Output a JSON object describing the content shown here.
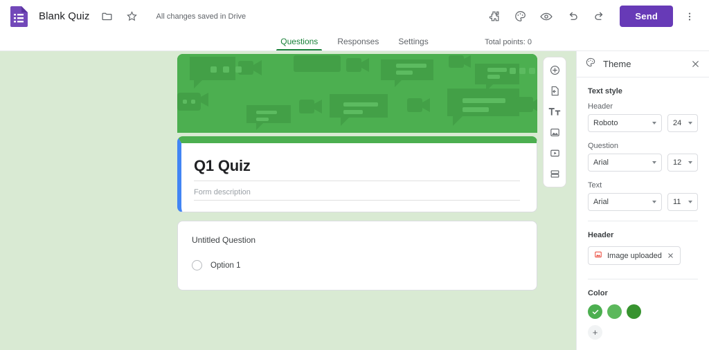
{
  "topbar": {
    "logo_icon": "forms-logo-icon",
    "doc_title": "Blank Quiz",
    "folder_icon": "folder-icon",
    "star_icon": "star-icon",
    "save_status": "All changes saved in Drive",
    "addons_icon": "puzzle-addons-icon",
    "theme_icon": "palette-theme-icon",
    "preview_icon": "eye-preview-icon",
    "undo_icon": "undo-icon",
    "redo_icon": "redo-icon",
    "send_label": "Send",
    "more_icon": "more-vert-icon"
  },
  "tabs": [
    {
      "label": "Questions",
      "active": true
    },
    {
      "label": "Responses",
      "active": false
    },
    {
      "label": "Settings",
      "active": false
    }
  ],
  "total_points": "Total points: 0",
  "form": {
    "banner_alt": "header-image-green-chat-video",
    "title": "Q1 Quiz",
    "description_placeholder": "Form description",
    "question": {
      "title": "Untitled Question",
      "options": [
        "Option 1"
      ]
    }
  },
  "float_toolbar": [
    {
      "icon": "add-question-icon"
    },
    {
      "icon": "import-questions-icon"
    },
    {
      "icon": "add-title-description-icon"
    },
    {
      "icon": "add-image-icon"
    },
    {
      "icon": "add-video-icon"
    },
    {
      "icon": "add-section-icon"
    }
  ],
  "theme_panel": {
    "icon": "palette-icon",
    "title": "Theme",
    "close_icon": "close-icon",
    "text_style_heading": "Text style",
    "fields": [
      {
        "label": "Header",
        "font": "Roboto",
        "size": "24"
      },
      {
        "label": "Question",
        "font": "Arial",
        "size": "12"
      },
      {
        "label": "Text",
        "font": "Arial",
        "size": "11"
      }
    ],
    "header_section": {
      "heading": "Header",
      "chip_icon": "image-icon",
      "chip_label": "Image uploaded",
      "chip_remove_icon": "close-icon"
    },
    "color_section": {
      "heading": "Color",
      "swatches": [
        {
          "hex": "#4caf50",
          "selected": true
        },
        {
          "hex": "#5cb85c",
          "selected": false
        },
        {
          "hex": "#37932f",
          "selected": false
        }
      ],
      "add_label": "+"
    }
  }
}
